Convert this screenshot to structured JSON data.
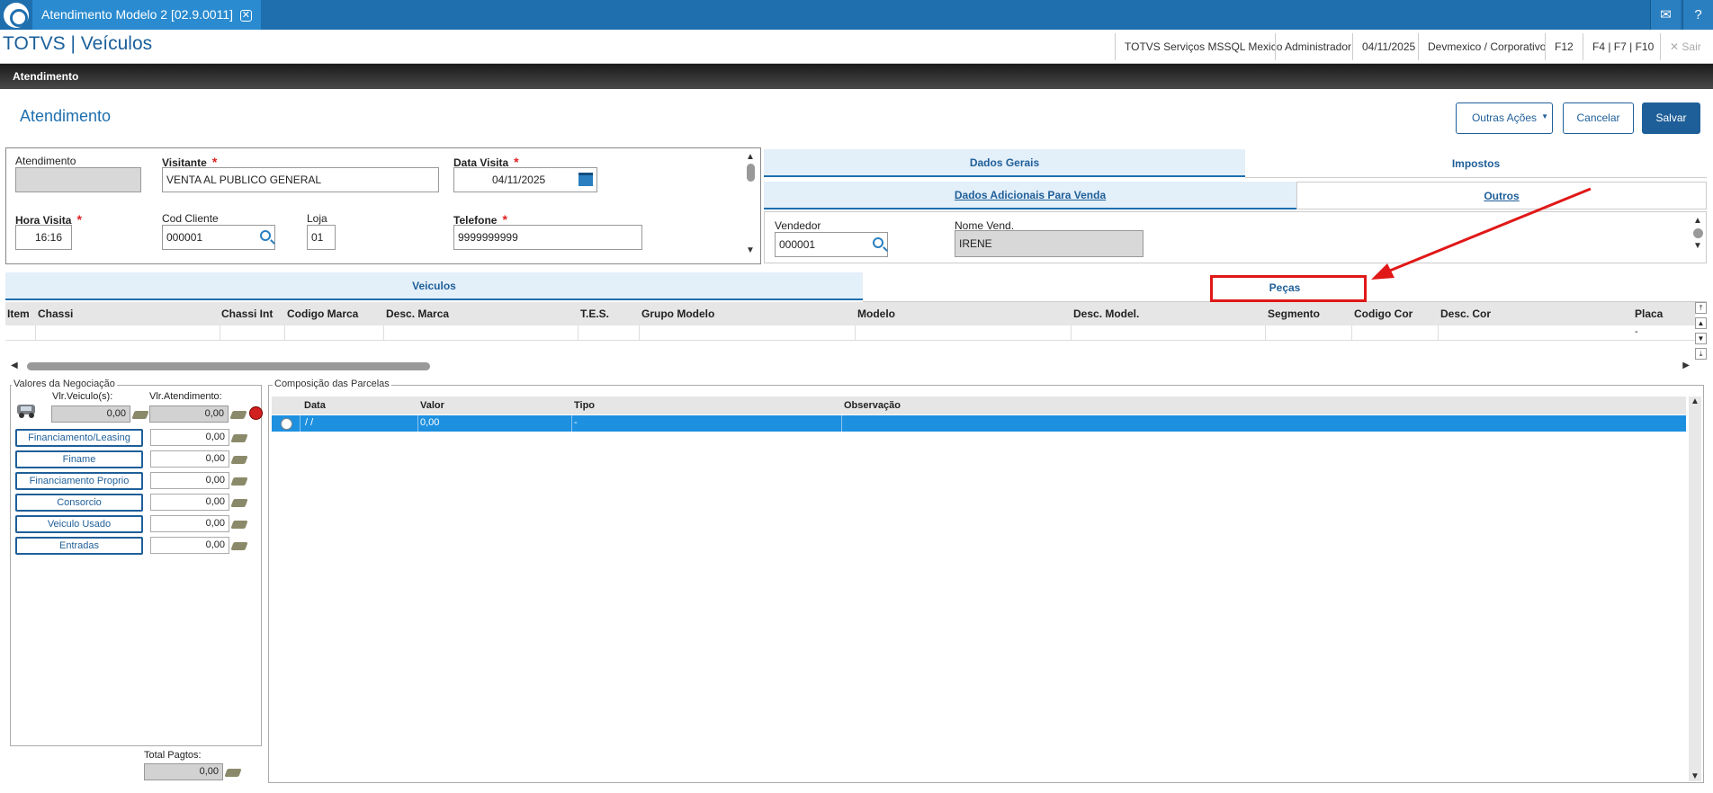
{
  "window": {
    "tab_title": "Atendimento Modelo 2 [02.9.0011]",
    "tab_close": "✕",
    "mail_icon": "✉",
    "help_icon": "?"
  },
  "header": {
    "app_title": "TOTVS | Veículos",
    "server": "TOTVS Serviços MSSQL Mexico",
    "user": "Administrador",
    "date": "04/11/2025",
    "env": "Devmexico / Corporativo",
    "f12": "F12",
    "fkeys": "F4 | F7 | F10",
    "sair": "Sair",
    "sair_icon": "✕"
  },
  "blackbar": {
    "title": "Atendimento"
  },
  "page": {
    "title": "Atendimento",
    "buttons": {
      "outras": "Outras Ações",
      "cancelar": "Cancelar",
      "salvar": "Salvar"
    }
  },
  "form": {
    "atendimento_label": "Atendimento",
    "atendimento_value": "",
    "visitante_label": "Visitante",
    "visitante_value": "VENTA AL PUBLICO GENERAL",
    "data_visita_label": "Data Visita",
    "data_visita_value": "04/11/2025",
    "hora_visita_label": "Hora Visita",
    "hora_visita_value": "16:16",
    "cod_cliente_label": "Cod Cliente",
    "cod_cliente_value": "000001",
    "loja_label": "Loja",
    "loja_value": "01",
    "telefone_label": "Telefone",
    "telefone_value": "9999999999",
    "required_mark": "*"
  },
  "right_tabs": {
    "dados_gerais": "Dados Gerais",
    "impostos": "Impostos",
    "dados_adicionais": "Dados Adicionais Para Venda",
    "outros": "Outros",
    "vendedor_label": "Vendedor",
    "vendedor_value": "000001",
    "nome_vend_label": "Nome Vend.",
    "nome_vend_value": "IRENE"
  },
  "mid_tabs": {
    "veiculos": "Veiculos",
    "pecas": "Peças"
  },
  "grid": {
    "columns": [
      "Item",
      "Chassi",
      "Chassi Int",
      "Codigo Marca",
      "Desc. Marca",
      "T.E.S.",
      "Grupo Modelo",
      "Modelo",
      "Desc. Model.",
      "Segmento",
      "Codigo Cor",
      "Desc. Cor",
      "Placa"
    ],
    "row_placa": "-"
  },
  "negociacao": {
    "legend": "Valores da Negociação",
    "vlr_veiculo_label": "Vlr.Veiculo(s):",
    "vlr_veiculo_value": "0,00",
    "vlr_atend_label": "Vlr.Atendimento:",
    "vlr_atend_value": "0,00",
    "items": [
      {
        "label": "Financiamento/Leasing",
        "value": "0,00"
      },
      {
        "label": "Finame",
        "value": "0,00"
      },
      {
        "label": "Financiamento Proprio",
        "value": "0,00"
      },
      {
        "label": "Consorcio",
        "value": "0,00"
      },
      {
        "label": "Veiculo Usado",
        "value": "0,00"
      },
      {
        "label": "Entradas",
        "value": "0,00"
      }
    ],
    "total_label": "Total Pagtos:",
    "total_value": "0,00"
  },
  "parcelas": {
    "legend": "Composição das Parcelas",
    "columns": [
      "Data",
      "Valor",
      "Tipo",
      "Observação"
    ],
    "row": {
      "data": "/ /",
      "valor": "0,00",
      "tipo": "-",
      "obs": ""
    }
  },
  "colors": {
    "brand_blue": "#1f6fae",
    "highlight_red": "#e01818",
    "selected_row": "#1e90e0"
  }
}
